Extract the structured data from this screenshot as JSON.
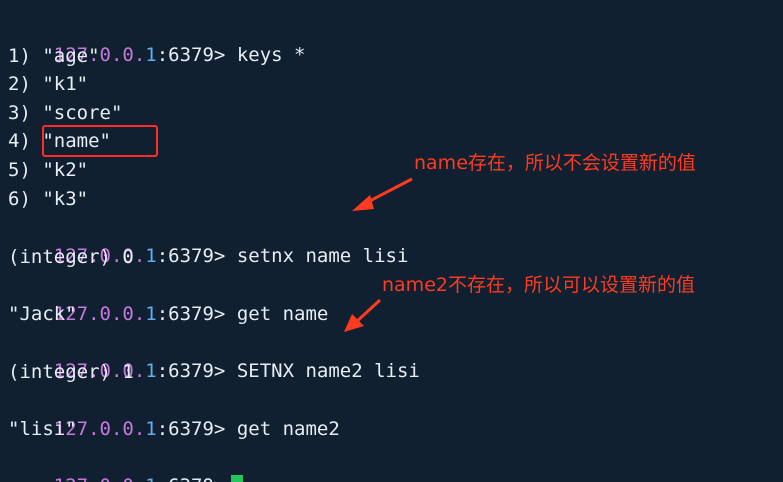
{
  "terminal": {
    "prompt": {
      "ip_prefix": "127.0.0.",
      "ip_last": "1",
      "port": ":6379>"
    },
    "lines": [
      {
        "type": "prompt",
        "cmd": "keys *"
      },
      {
        "type": "output",
        "text": "1) \"age\""
      },
      {
        "type": "output",
        "text": "2) \"k1\""
      },
      {
        "type": "output",
        "text": "3) \"score\""
      },
      {
        "type": "output",
        "text": "4) \"name\""
      },
      {
        "type": "output",
        "text": "5) \"k2\""
      },
      {
        "type": "output",
        "text": "6) \"k3\""
      },
      {
        "type": "prompt",
        "cmd": "setnx name lisi"
      },
      {
        "type": "output",
        "text": "(integer) 0"
      },
      {
        "type": "prompt",
        "cmd": "get name"
      },
      {
        "type": "output",
        "text": "\"Jack\""
      },
      {
        "type": "prompt",
        "cmd": "SETNX name2 lisi"
      },
      {
        "type": "output",
        "text": "(integer) 1"
      },
      {
        "type": "prompt",
        "cmd": "get name2"
      },
      {
        "type": "output",
        "text": "\"lisi\""
      },
      {
        "type": "prompt",
        "cmd": ""
      }
    ]
  },
  "annotations": {
    "note1": "name存在，所以不会设置新的值",
    "note2": "name2不存在，所以可以设置新的值"
  },
  "colors": {
    "background": "#102030",
    "ip": "#c678dd",
    "ip_last": "#61afef",
    "annotation": "#ff3b1f",
    "highlight_box": "#ff2a2a",
    "cursor": "#22c55e"
  }
}
